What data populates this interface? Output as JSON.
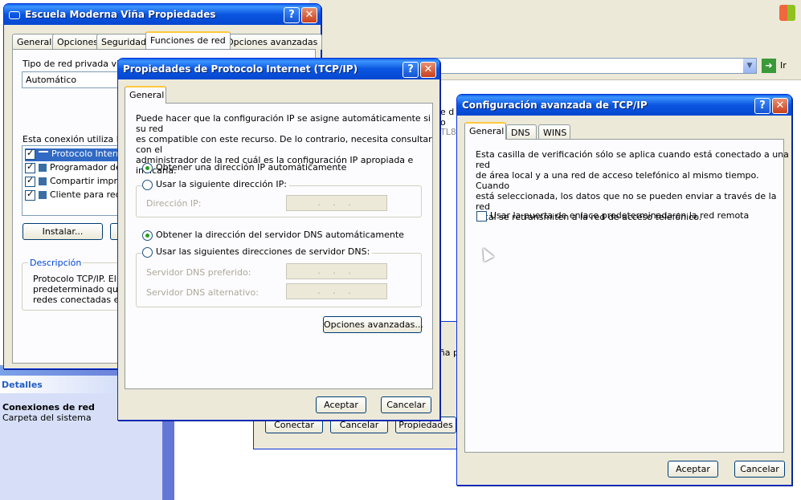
{
  "bg_window": {
    "go_label": "Ir",
    "buttons": {
      "connect": "Conectar",
      "cancel": "Cancelar",
      "properties": "Propiedades"
    },
    "fragment_a": "e d",
    "fragment_b": "o",
    "fragment_c": "TL8",
    "fragment_d": "eña p"
  },
  "left_pane": {
    "details_title": "Detalles",
    "item_title": "Conexiones de red",
    "item_subtitle": "Carpeta del sistema"
  },
  "props_window": {
    "title": "Escuela Moderna Viña Propiedades",
    "tabs": [
      "General",
      "Opciones",
      "Seguridad",
      "Funciones de red",
      "Opciones avanzadas"
    ],
    "vpn_type_label": "Tipo de red privada virtua",
    "vpn_type_value": "Automático",
    "items_label": "Esta conexión utiliza los",
    "items": [
      "Protocolo Interne",
      "Programador de p",
      "Compartir impreso",
      "Cliente para rede"
    ],
    "install_button": "Instalar...",
    "description_title": "Descripción",
    "description_lines": [
      "Protocolo TCP/IP. El p",
      "predeterminado que p",
      "redes conectadas entr"
    ]
  },
  "tcpip_window": {
    "title": "Propiedades de Protocolo Internet (TCP/IP)",
    "tab": "General",
    "intro_lines": [
      "Puede hacer que la configuración IP se asigne automáticamente si su red",
      "es compatible con este recurso. De lo contrario, necesita consultar con el",
      "administrador de la red cuál es la configuración IP apropiada e indicarla."
    ],
    "auto_ip": "Obtener una dirección IP automáticamente",
    "manual_ip": "Usar la siguiente dirección IP:",
    "ip_label": "Dirección IP:",
    "ip_placeholder": ". . .",
    "auto_dns": "Obtener la dirección del servidor DNS automáticamente",
    "manual_dns": "Usar las siguientes direcciones de servidor DNS:",
    "dns_pref_label": "Servidor DNS preferido:",
    "dns_alt_label": "Servidor DNS alternativo:",
    "advanced_button": "Opciones avanzadas...",
    "ok_button": "Aceptar",
    "cancel_button": "Cancelar"
  },
  "adv_window": {
    "title": "Configuración avanzada de TCP/IP",
    "tabs": [
      "General",
      "DNS",
      "WINS"
    ],
    "info_lines": [
      "Esta casilla de verificación sólo se aplica cuando está conectado a una red",
      "de área local y a una red de acceso telefónico al mismo tiempo. Cuando",
      "está seleccionada, los datos que no se pueden enviar a través de la red",
      "local se retransmiten a la red de acceso telefónico."
    ],
    "checkbox_label": "Usar la puerta de enlace predeterminada en la red remota",
    "ok_button": "Aceptar",
    "cancel_button": "Cancelar"
  },
  "colors": {
    "titlebar": "#0a55e0",
    "face": "#ece9d8",
    "panel": "#fcfcfe",
    "details_blue": "#215dc6"
  }
}
